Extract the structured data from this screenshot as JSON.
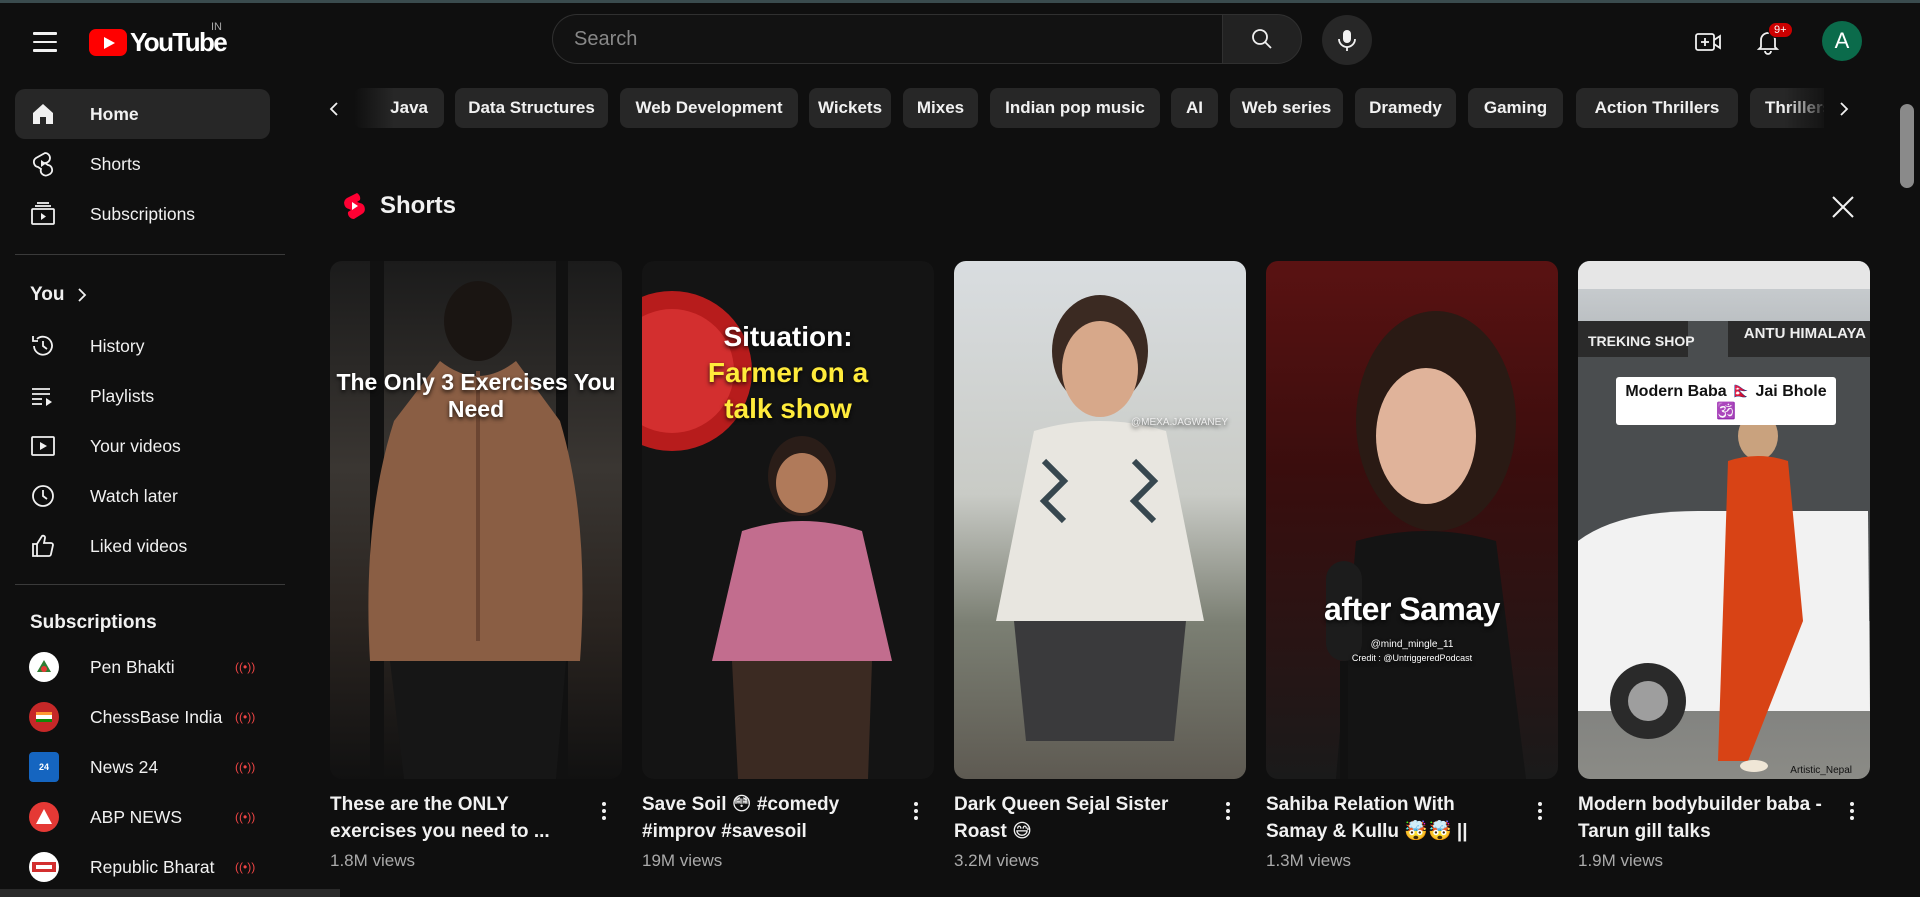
{
  "header": {
    "logo_text": "YouTube",
    "country": "IN",
    "search_placeholder": "Search",
    "notifications_badge": "9+",
    "avatar_letter": "A"
  },
  "sidebar": {
    "main": [
      {
        "label": "Home",
        "icon": "home-icon",
        "active": true
      },
      {
        "label": "Shorts",
        "icon": "shorts-icon"
      },
      {
        "label": "Subscriptions",
        "icon": "subscriptions-icon"
      }
    ],
    "you_title": "You",
    "you": [
      {
        "label": "History",
        "icon": "history-icon"
      },
      {
        "label": "Playlists",
        "icon": "playlists-icon"
      },
      {
        "label": "Your videos",
        "icon": "your-videos-icon"
      },
      {
        "label": "Watch later",
        "icon": "watch-later-icon"
      },
      {
        "label": "Liked videos",
        "icon": "liked-icon"
      }
    ],
    "subscriptions_title": "Subscriptions",
    "subscriptions": [
      {
        "label": "Pen Bhakti",
        "avatar_color": "#ffffff"
      },
      {
        "label": "ChessBase India",
        "avatar_color": "#c62828"
      },
      {
        "label": "News 24",
        "avatar_color": "#1565c0"
      },
      {
        "label": "ABP NEWS",
        "avatar_color": "#e53935"
      },
      {
        "label": "Republic Bharat",
        "avatar_color": "#ffffff"
      }
    ]
  },
  "chips": [
    "Java",
    "Data Structures",
    "Web Development",
    "Wickets",
    "Mixes",
    "Indian pop music",
    "AI",
    "Web series",
    "Dramedy",
    "Gaming",
    "Action Thrillers",
    "Thrillers"
  ],
  "shorts": {
    "title": "Shorts",
    "items": [
      {
        "title": "These are the ONLY exercises you need to ...",
        "views": "1.8M views",
        "overlay": "The Only 3 Exercises You Need"
      },
      {
        "title": "Save Soil 😳 #comedy #improv #savesoil",
        "views": "19M views",
        "overlay1": "Situation:",
        "overlay2": "Farmer on a talk show"
      },
      {
        "title": "Dark Queen Sejal Sister Roast 😅",
        "views": "3.2M views",
        "overlay": "@MEXA.JAGWANEY"
      },
      {
        "title": "Sahiba Relation With Samay & Kullu 🤯🤯 || Ft....",
        "views": "1.3M views",
        "overlay": "after Samay",
        "overlay_sub": "@mind_mingle_11",
        "overlay_credit": "Credit : @UntriggeredPodcast"
      },
      {
        "title": "Modern bodybuilder baba - Tarun gill talks",
        "views": "1.9M views",
        "overlay": "Modern Baba 🇳🇵 Jai Bhole 🕉️",
        "sign1": "TREKING SHOP",
        "sign2": "ANTU HIMALAYA",
        "watermark": "Artistic_Nepal"
      }
    ]
  }
}
